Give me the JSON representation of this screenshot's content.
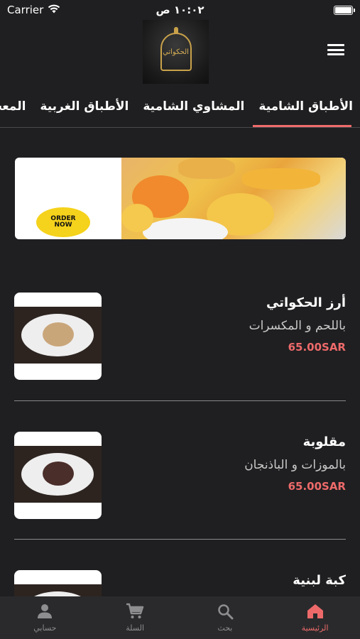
{
  "status_bar": {
    "carrier": "Carrier",
    "time": "١٠:٠٢ ص",
    "battery_percent": 100
  },
  "header": {
    "logo_text": "الحكواتي",
    "menu_icon": "hamburger-menu-icon"
  },
  "tabs": [
    {
      "label": "الأطباق الشامية",
      "active": true
    },
    {
      "label": "المشاوي الشامية",
      "active": false
    },
    {
      "label": "الأطباق الغربية",
      "active": false
    },
    {
      "label": "المعجنا",
      "active": false
    }
  ],
  "banner": {
    "order_line1": "ORDER",
    "order_line2": "NOW"
  },
  "products": [
    {
      "name": "أرز الحكواتي",
      "description": "باللحم و المكسرات",
      "price": "65.00SAR"
    },
    {
      "name": "مقلوبة",
      "description": "بالموزات و الباذنجان",
      "price": "65.00SAR"
    },
    {
      "name": "كبة لبنية",
      "description": "",
      "price": ""
    }
  ],
  "bottom_nav": [
    {
      "label": "الرئيسية",
      "icon": "home-icon",
      "active": true
    },
    {
      "label": "بحث",
      "icon": "search-icon",
      "active": false
    },
    {
      "label": "السلة",
      "icon": "cart-icon",
      "active": false
    },
    {
      "label": "حسابي",
      "icon": "user-icon",
      "active": false
    }
  ],
  "colors": {
    "background": "#1f1f21",
    "accent": "#ee6a6a",
    "nav_background": "#2a2a2c"
  }
}
